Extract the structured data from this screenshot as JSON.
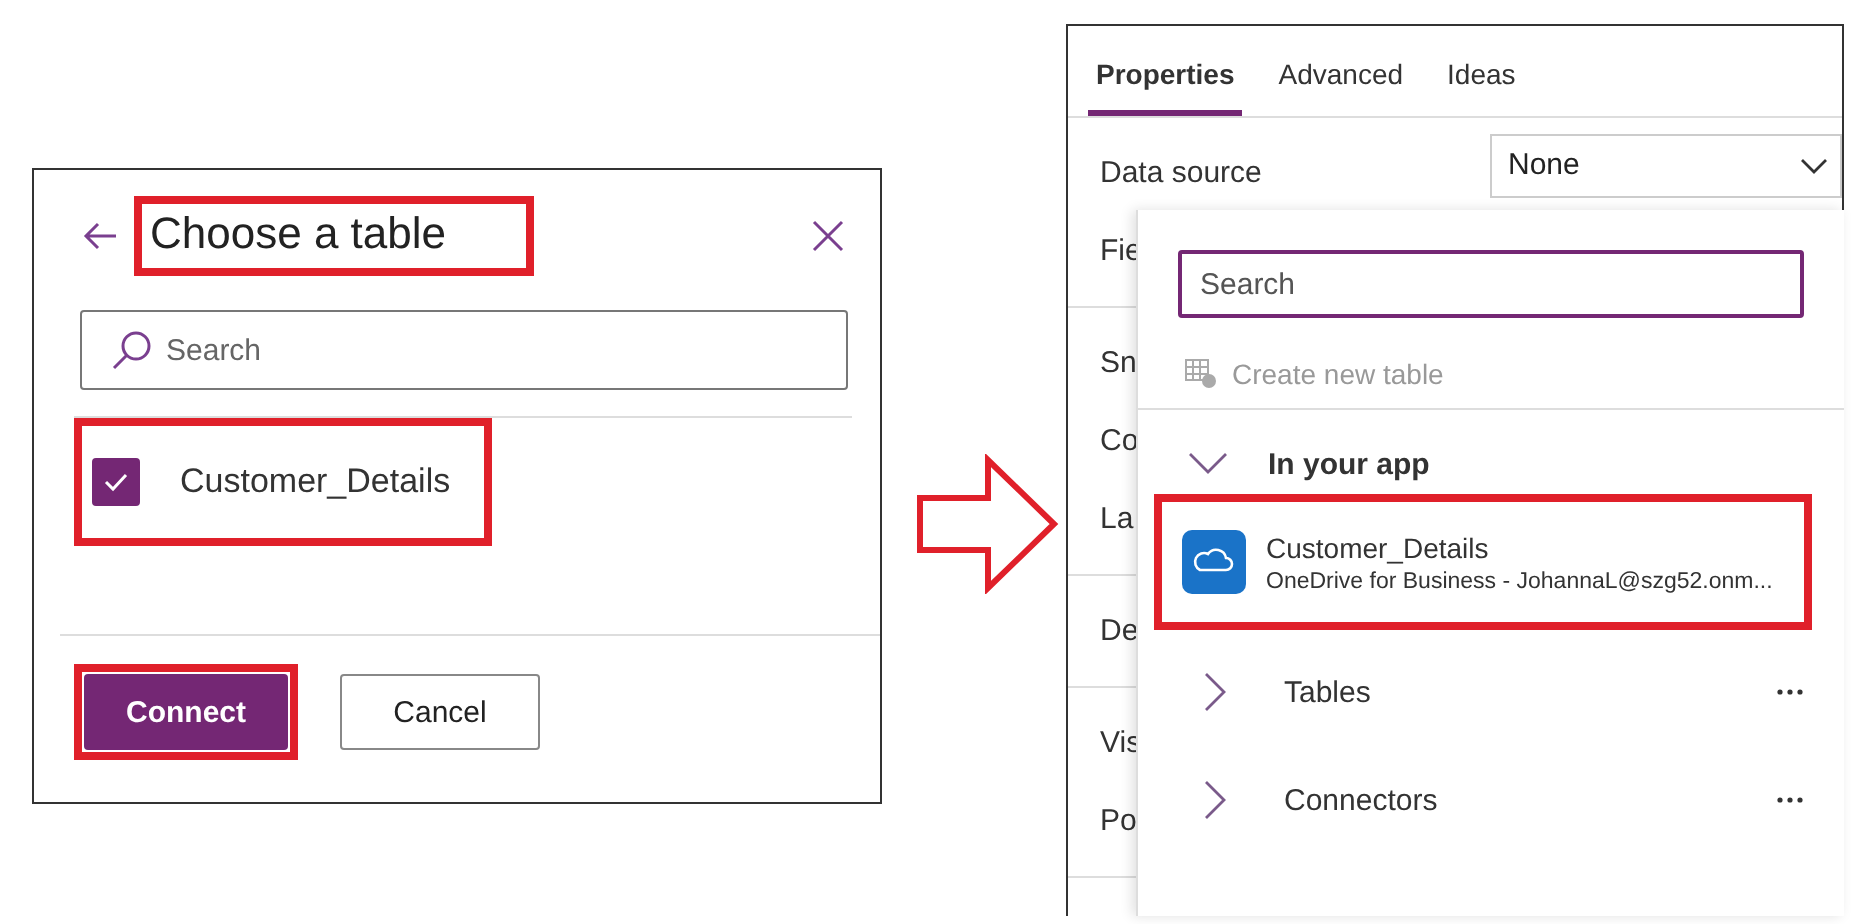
{
  "left_dialog": {
    "title": "Choose a table",
    "title_highlighted": true,
    "search": {
      "placeholder": "Search"
    },
    "tables": [
      {
        "name": "Customer_Details",
        "checked": true,
        "highlighted": true
      }
    ],
    "buttons": [
      {
        "label": "Connect",
        "kind": "primary",
        "highlighted": true
      },
      {
        "label": "Cancel",
        "kind": "secondary",
        "highlighted": false
      }
    ]
  },
  "properties_panel": {
    "tabs": [
      {
        "label": "Properties",
        "selected": true
      },
      {
        "label": "Advanced",
        "selected": false
      },
      {
        "label": "Ideas",
        "selected": false
      }
    ],
    "sections": [
      {
        "rows": [
          {
            "label": "Data source",
            "value": "None"
          },
          {
            "label": "Fie"
          }
        ]
      },
      {
        "rows": [
          {
            "label": "Sn"
          },
          {
            "label": "Co"
          },
          {
            "label": "La"
          }
        ]
      },
      {
        "rows": [
          {
            "label": "De"
          }
        ]
      },
      {
        "rows": [
          {
            "label": "Vis"
          },
          {
            "label": "Po"
          }
        ]
      }
    ],
    "dropdown": {
      "search": {
        "placeholder": "Search"
      },
      "create_action": {
        "label": "Create new table",
        "disabled": true
      },
      "groups": [
        {
          "label": "In your app",
          "expanded": true,
          "has_menu": false,
          "items": [
            {
              "name": "Customer_Details",
              "source": "OneDrive for Business - JohannaL@szg52.onm...",
              "highlighted": true
            }
          ]
        },
        {
          "label": "Tables",
          "expanded": false,
          "has_menu": true
        },
        {
          "label": "Connectors",
          "expanded": false,
          "has_menu": true
        }
      ]
    }
  }
}
